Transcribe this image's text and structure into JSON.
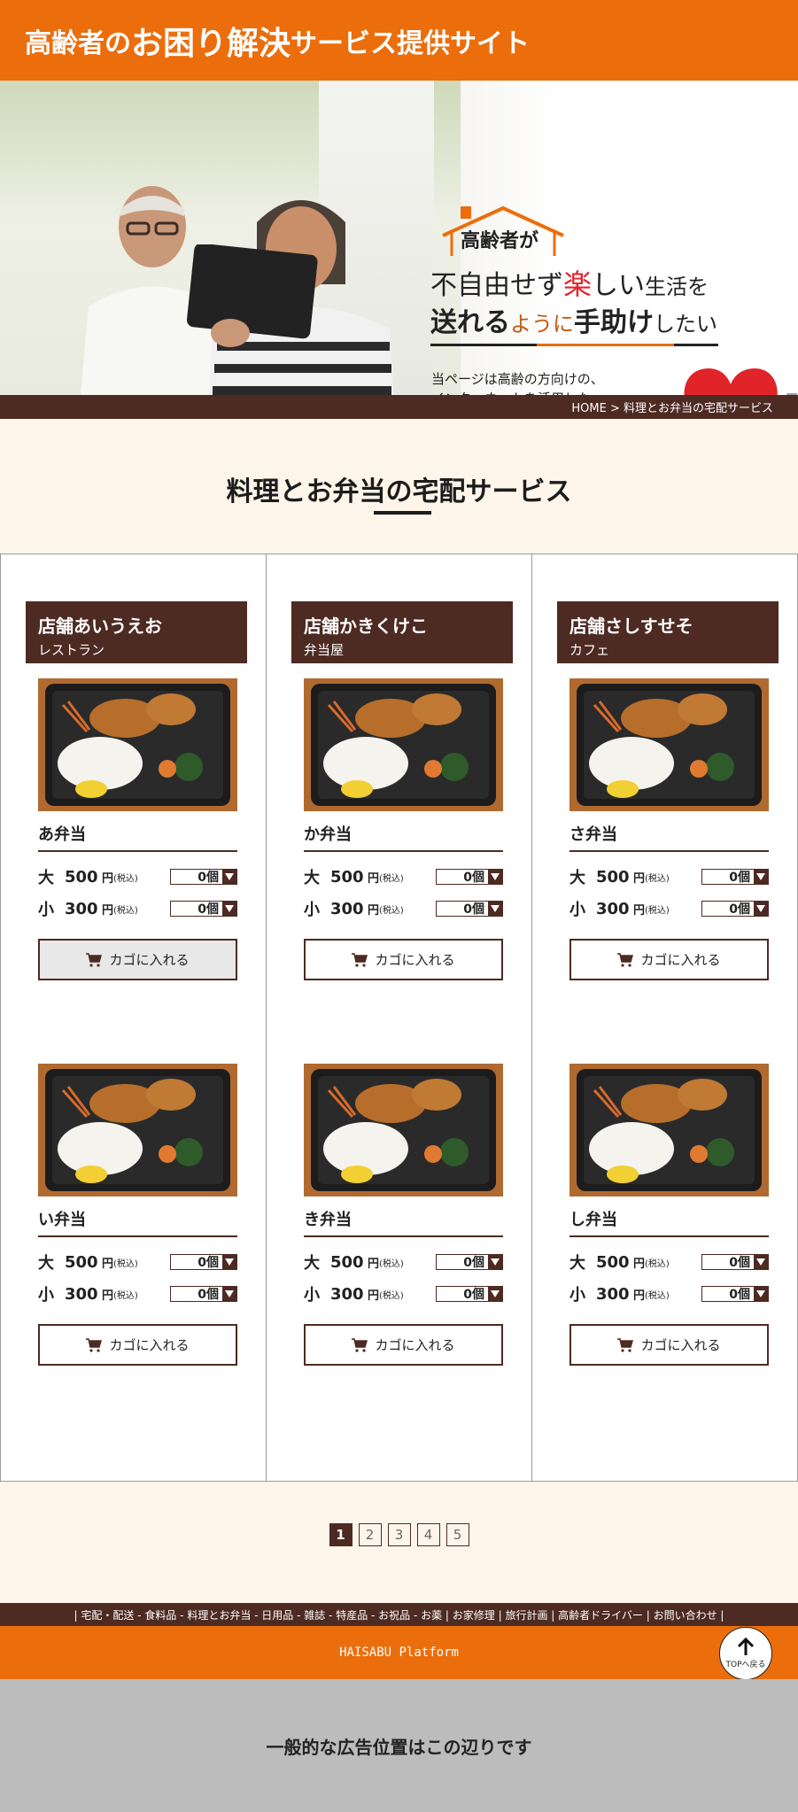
{
  "header": {
    "title_part1": "高齢者の",
    "title_part2": "お困り解決",
    "title_part3": "サービス提供サイト"
  },
  "hero": {
    "badge": "高齢者が",
    "line1_a": "不自由せず",
    "line1_b": "楽",
    "line1_c": "しい",
    "line1_d": "生活を",
    "line2_a": "送れる",
    "line2_b": "ように",
    "line2_c": "手助け",
    "line2_d": "したい",
    "description": "当ページは高齢の方向けの、\nインターネットを活用した\nサービスを提供するサイトです。"
  },
  "breadcrumb": "HOME > 料理とお弁当の宅配サービス",
  "section_title": "料理とお弁当の宅配サービス",
  "stores": [
    {
      "name": "店舗あいうえお",
      "type": "レストラン",
      "items": [
        {
          "name": "あ弁当",
          "large_price": "500",
          "small_price": "300",
          "large_qty": "0個",
          "small_qty": "0個"
        },
        {
          "name": "い弁当",
          "large_price": "500",
          "small_price": "300",
          "large_qty": "0個",
          "small_qty": "0個"
        }
      ]
    },
    {
      "name": "店舗かきくけこ",
      "type": "弁当屋",
      "items": [
        {
          "name": "か弁当",
          "large_price": "500",
          "small_price": "300",
          "large_qty": "0個",
          "small_qty": "0個"
        },
        {
          "name": "き弁当",
          "large_price": "500",
          "small_price": "300",
          "large_qty": "0個",
          "small_qty": "0個"
        }
      ]
    },
    {
      "name": "店舗さしすせそ",
      "type": "カフェ",
      "items": [
        {
          "name": "さ弁当",
          "large_price": "500",
          "small_price": "300",
          "large_qty": "0個",
          "small_qty": "0個"
        },
        {
          "name": "し弁当",
          "large_price": "500",
          "small_price": "300",
          "large_qty": "0個",
          "small_qty": "0個"
        }
      ]
    }
  ],
  "labels": {
    "large": "大",
    "small": "小",
    "yen": "円",
    "tax": "(税込)",
    "cart_button": "カゴに入れる"
  },
  "pagination": [
    "1",
    "2",
    "3",
    "4",
    "5"
  ],
  "footer_nav": "| 宅配・配送 - 食料品 - 料理とお弁当 - 日用品 - 雑誌 - 特産品 - お祝品 - お薬 | お家修理 | 旅行計画 | 高齢者ドライバー | お問い合わせ |",
  "footer_brand": "HAISABU Platform",
  "top_button": "TOPへ戻る",
  "ad_text": "一般的な広告位置はこの辺りです",
  "colors": {
    "orange": "#ec6d0c",
    "brown": "#4d2a22",
    "cream": "#fdf5ea"
  }
}
